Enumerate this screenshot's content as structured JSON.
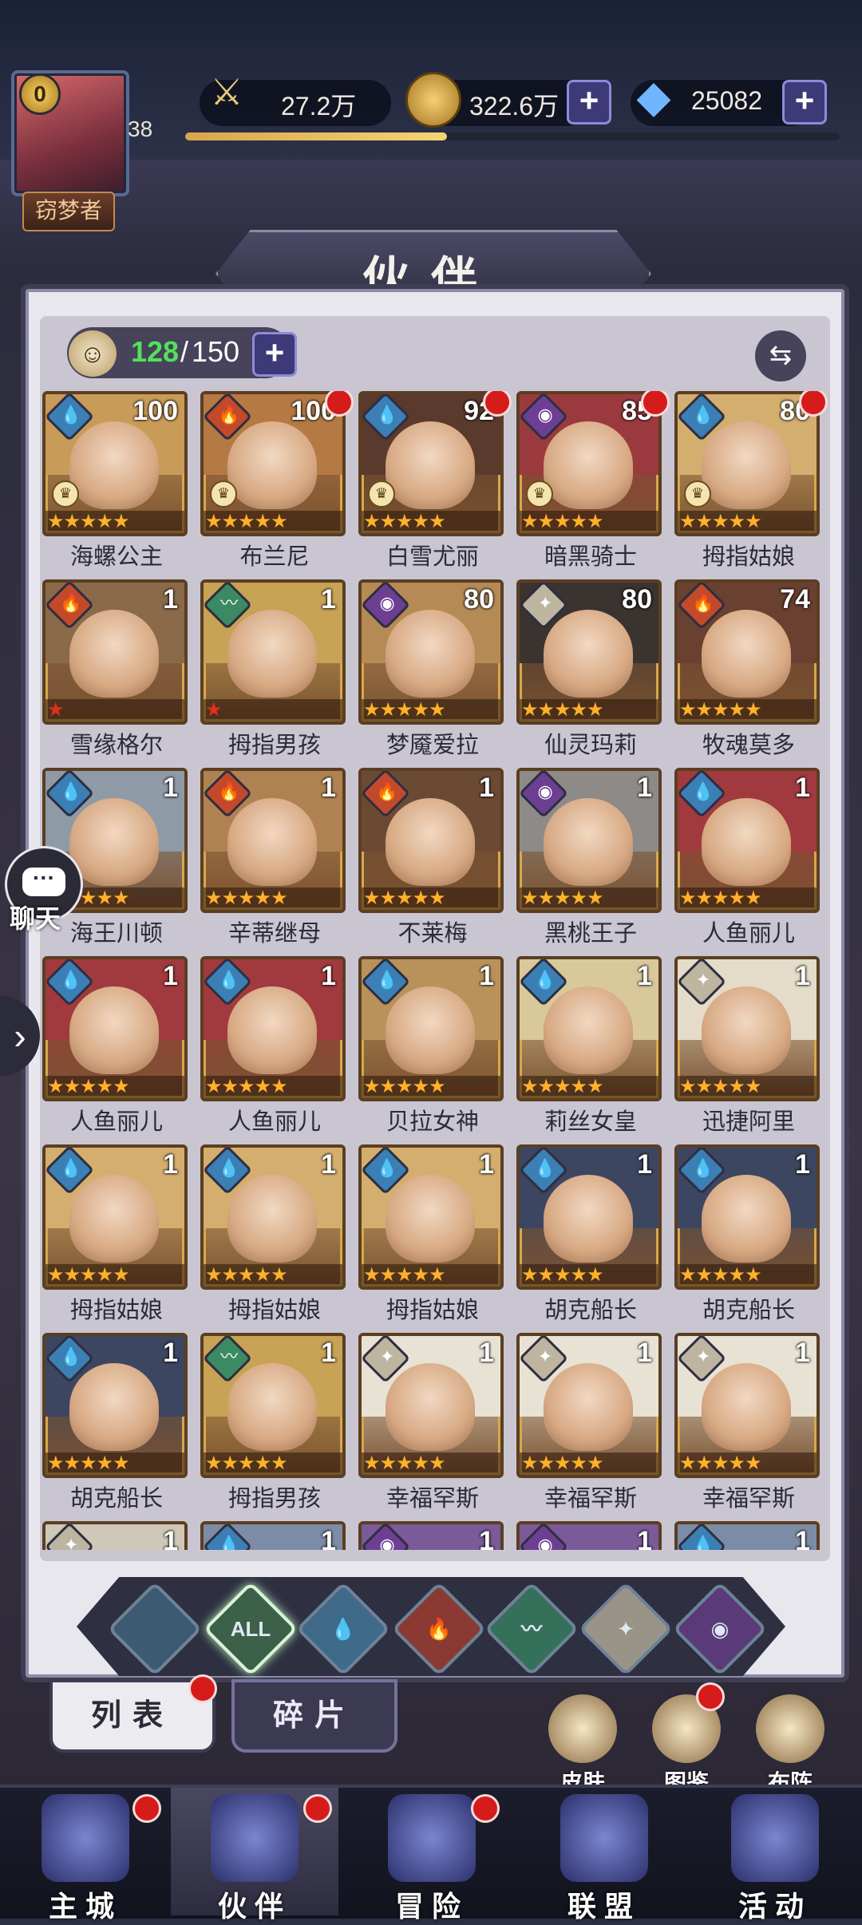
{
  "player": {
    "level_badge": "0",
    "level": "38",
    "rank_title": "窃梦者",
    "exp_fill_percent": 40
  },
  "resources": {
    "power": "27.2万",
    "gold": "322.6万",
    "diamonds": "25082"
  },
  "header": {
    "title": "伙伴"
  },
  "roster": {
    "current": "128",
    "separator": "/",
    "max": "150"
  },
  "heroes": [
    {
      "name": "海螺公主",
      "level": "100",
      "element": "water",
      "stars": 5,
      "crown": true,
      "dot": false,
      "color": "#c99b58"
    },
    {
      "name": "布兰尼",
      "level": "100",
      "element": "fire",
      "stars": 5,
      "crown": true,
      "dot": true,
      "color": "#b57944"
    },
    {
      "name": "白雪尤丽",
      "level": "92",
      "element": "water",
      "stars": 5,
      "crown": true,
      "dot": true,
      "color": "#5a3a2c"
    },
    {
      "name": "暗黑骑士",
      "level": "85",
      "element": "dark",
      "stars": 5,
      "crown": true,
      "dot": true,
      "color": "#9b3a3e"
    },
    {
      "name": "拇指姑娘",
      "level": "80",
      "element": "water",
      "stars": 5,
      "crown": true,
      "dot": true,
      "color": "#d4ae6e"
    },
    {
      "name": "雪缘格尔",
      "level": "1",
      "element": "fire",
      "stars": 1,
      "crown": false,
      "dot": false,
      "color": "#8a6a48"
    },
    {
      "name": "拇指男孩",
      "level": "1",
      "element": "wind",
      "stars": 1,
      "crown": false,
      "dot": false,
      "color": "#c8a255"
    },
    {
      "name": "梦魇爱拉",
      "level": "80",
      "element": "dark",
      "stars": 5,
      "crown": false,
      "dot": false,
      "color": "#b58a55"
    },
    {
      "name": "仙灵玛莉",
      "level": "80",
      "element": "light",
      "stars": 5,
      "crown": false,
      "dot": false,
      "color": "#3a3330"
    },
    {
      "name": "牧魂莫多",
      "level": "74",
      "element": "fire",
      "stars": 5,
      "crown": false,
      "dot": false,
      "color": "#6a4030"
    },
    {
      "name": "海王川顿",
      "level": "1",
      "element": "water",
      "stars": 5,
      "crown": false,
      "dot": false,
      "color": "#8e9aa6"
    },
    {
      "name": "辛蒂继母",
      "level": "1",
      "element": "fire",
      "stars": 5,
      "crown": false,
      "dot": false,
      "color": "#b08252"
    },
    {
      "name": "不莱梅",
      "level": "1",
      "element": "fire",
      "stars": 5,
      "crown": false,
      "dot": false,
      "color": "#6b4a34"
    },
    {
      "name": "黑桃王子",
      "level": "1",
      "element": "dark",
      "stars": 5,
      "crown": false,
      "dot": false,
      "color": "#8d8a88"
    },
    {
      "name": "人鱼丽儿",
      "level": "1",
      "element": "water",
      "stars": 5,
      "crown": false,
      "dot": false,
      "color": "#a03a3e"
    },
    {
      "name": "人鱼丽儿",
      "level": "1",
      "element": "water",
      "stars": 5,
      "crown": false,
      "dot": false,
      "color": "#a03a3e"
    },
    {
      "name": "人鱼丽儿",
      "level": "1",
      "element": "water",
      "stars": 5,
      "crown": false,
      "dot": false,
      "color": "#a03a3e"
    },
    {
      "name": "贝拉女神",
      "level": "1",
      "element": "water",
      "stars": 5,
      "crown": false,
      "dot": false,
      "color": "#b8925a"
    },
    {
      "name": "莉丝女皇",
      "level": "1",
      "element": "water",
      "stars": 5,
      "crown": false,
      "dot": false,
      "color": "#d8c89a"
    },
    {
      "name": "迅捷阿里",
      "level": "1",
      "element": "light",
      "stars": 5,
      "crown": false,
      "dot": false,
      "color": "#e4dcc8"
    },
    {
      "name": "拇指姑娘",
      "level": "1",
      "element": "water",
      "stars": 5,
      "crown": false,
      "dot": false,
      "color": "#d4ae6e"
    },
    {
      "name": "拇指姑娘",
      "level": "1",
      "element": "water",
      "stars": 5,
      "crown": false,
      "dot": false,
      "color": "#d4ae6e"
    },
    {
      "name": "拇指姑娘",
      "level": "1",
      "element": "water",
      "stars": 5,
      "crown": false,
      "dot": false,
      "color": "#d4ae6e"
    },
    {
      "name": "胡克船长",
      "level": "1",
      "element": "water",
      "stars": 5,
      "crown": false,
      "dot": false,
      "color": "#3c4660"
    },
    {
      "name": "胡克船长",
      "level": "1",
      "element": "water",
      "stars": 5,
      "crown": false,
      "dot": false,
      "color": "#3c4660"
    },
    {
      "name": "胡克船长",
      "level": "1",
      "element": "water",
      "stars": 5,
      "crown": false,
      "dot": false,
      "color": "#3c4660"
    },
    {
      "name": "拇指男孩",
      "level": "1",
      "element": "wind",
      "stars": 5,
      "crown": false,
      "dot": false,
      "color": "#c8a255"
    },
    {
      "name": "幸福罕斯",
      "level": "1",
      "element": "light",
      "stars": 5,
      "crown": false,
      "dot": false,
      "color": "#e8e2d4"
    },
    {
      "name": "幸福罕斯",
      "level": "1",
      "element": "light",
      "stars": 5,
      "crown": false,
      "dot": false,
      "color": "#e8e2d4"
    },
    {
      "name": "幸福罕斯",
      "level": "1",
      "element": "light",
      "stars": 5,
      "crown": false,
      "dot": false,
      "color": "#e8e2d4"
    },
    {
      "name": "",
      "level": "1",
      "element": "light",
      "stars": 0,
      "crown": false,
      "dot": false,
      "color": "#cfc8b8"
    },
    {
      "name": "",
      "level": "1",
      "element": "water",
      "stars": 0,
      "crown": false,
      "dot": false,
      "color": "#7c8ca6"
    },
    {
      "name": "",
      "level": "1",
      "element": "dark",
      "stars": 0,
      "crown": false,
      "dot": false,
      "color": "#7a5a98"
    },
    {
      "name": "",
      "level": "1",
      "element": "dark",
      "stars": 0,
      "crown": false,
      "dot": false,
      "color": "#7a5a98"
    },
    {
      "name": "",
      "level": "1",
      "element": "water",
      "stars": 0,
      "crown": false,
      "dot": false,
      "color": "#7c8ca6"
    }
  ],
  "filters": [
    {
      "name": "filter-water-dark",
      "label": "",
      "color": "#3c5a72",
      "active": false
    },
    {
      "name": "filter-all",
      "label": "ALL",
      "color": "#3c6048",
      "active": true
    },
    {
      "name": "filter-water",
      "label": "💧",
      "color": "#3f6a8a",
      "active": false
    },
    {
      "name": "filter-fire",
      "label": "🔥",
      "color": "#8a3a32",
      "active": false
    },
    {
      "name": "filter-wind",
      "label": "〰",
      "color": "#35705a",
      "active": false
    },
    {
      "name": "filter-light",
      "label": "✦",
      "color": "#9a9488",
      "active": false
    },
    {
      "name": "filter-dark",
      "label": "◉",
      "color": "#5a3a78",
      "active": false
    }
  ],
  "subtabs": {
    "list": "列表",
    "fragments": "碎片"
  },
  "side_buttons": {
    "skin": "皮肤",
    "codex": "图鉴",
    "formation": "布阵"
  },
  "chat": {
    "label": "聊天"
  },
  "nav": {
    "city": "主城",
    "partner": "伙伴",
    "adventure": "冒险",
    "alliance": "联盟",
    "event": "活动"
  },
  "colors": {
    "element_water": "#3b7fb5",
    "element_fire": "#c24a2a",
    "element_dark": "#6d3f92",
    "element_wind": "#3b8a63",
    "element_light": "#bdb5a0",
    "accent_exp": "#f0c765",
    "notify": "#d61b1b"
  }
}
